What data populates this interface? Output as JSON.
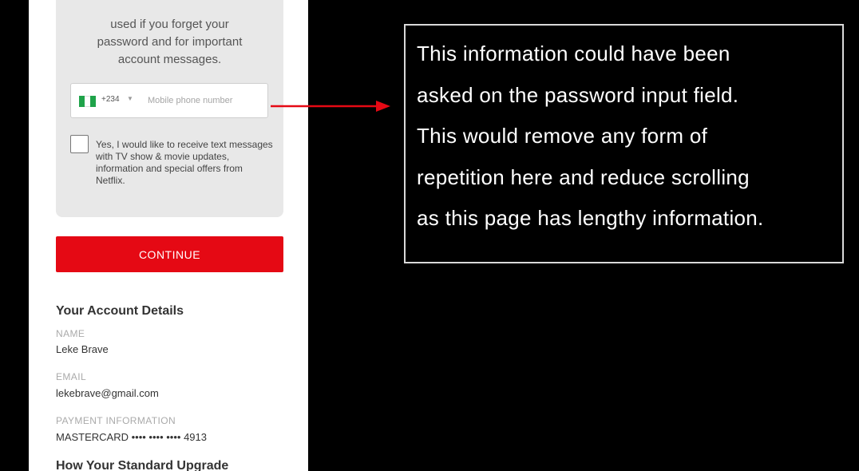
{
  "signup": {
    "sms_description": "used if you forget your\npassword and for important\naccount messages.",
    "phone_input": {
      "country_code": "+234",
      "placeholder": "Mobile phone number",
      "flag_colors": [
        "#1fa34a",
        "#ffffff",
        "#1fa34a"
      ]
    },
    "sms_optin_label": "Yes, I would like to receive text messages with TV show & movie updates, information and special offers from Netflix.",
    "continue_label": "CONTINUE",
    "account_details": {
      "heading": "Your Account Details",
      "name_label": "NAME",
      "name_value": "Leke Brave",
      "email_label": "EMAIL",
      "email_value": "lekebrave@gmail.com",
      "payment_label": "PAYMENT INFORMATION",
      "payment_value": "MASTERCARD •••• •••• •••• 4913"
    },
    "next_heading": "How Your Standard Upgrade"
  },
  "annotation": {
    "text": "This information could have been\nasked on the password input field.\nThis would remove any form of\nrepetition here and reduce scrolling\nas this page has lengthy information."
  },
  "colors": {
    "brand_red": "#e50914",
    "background": "#000000",
    "annotation_arrow": "#e50914"
  }
}
